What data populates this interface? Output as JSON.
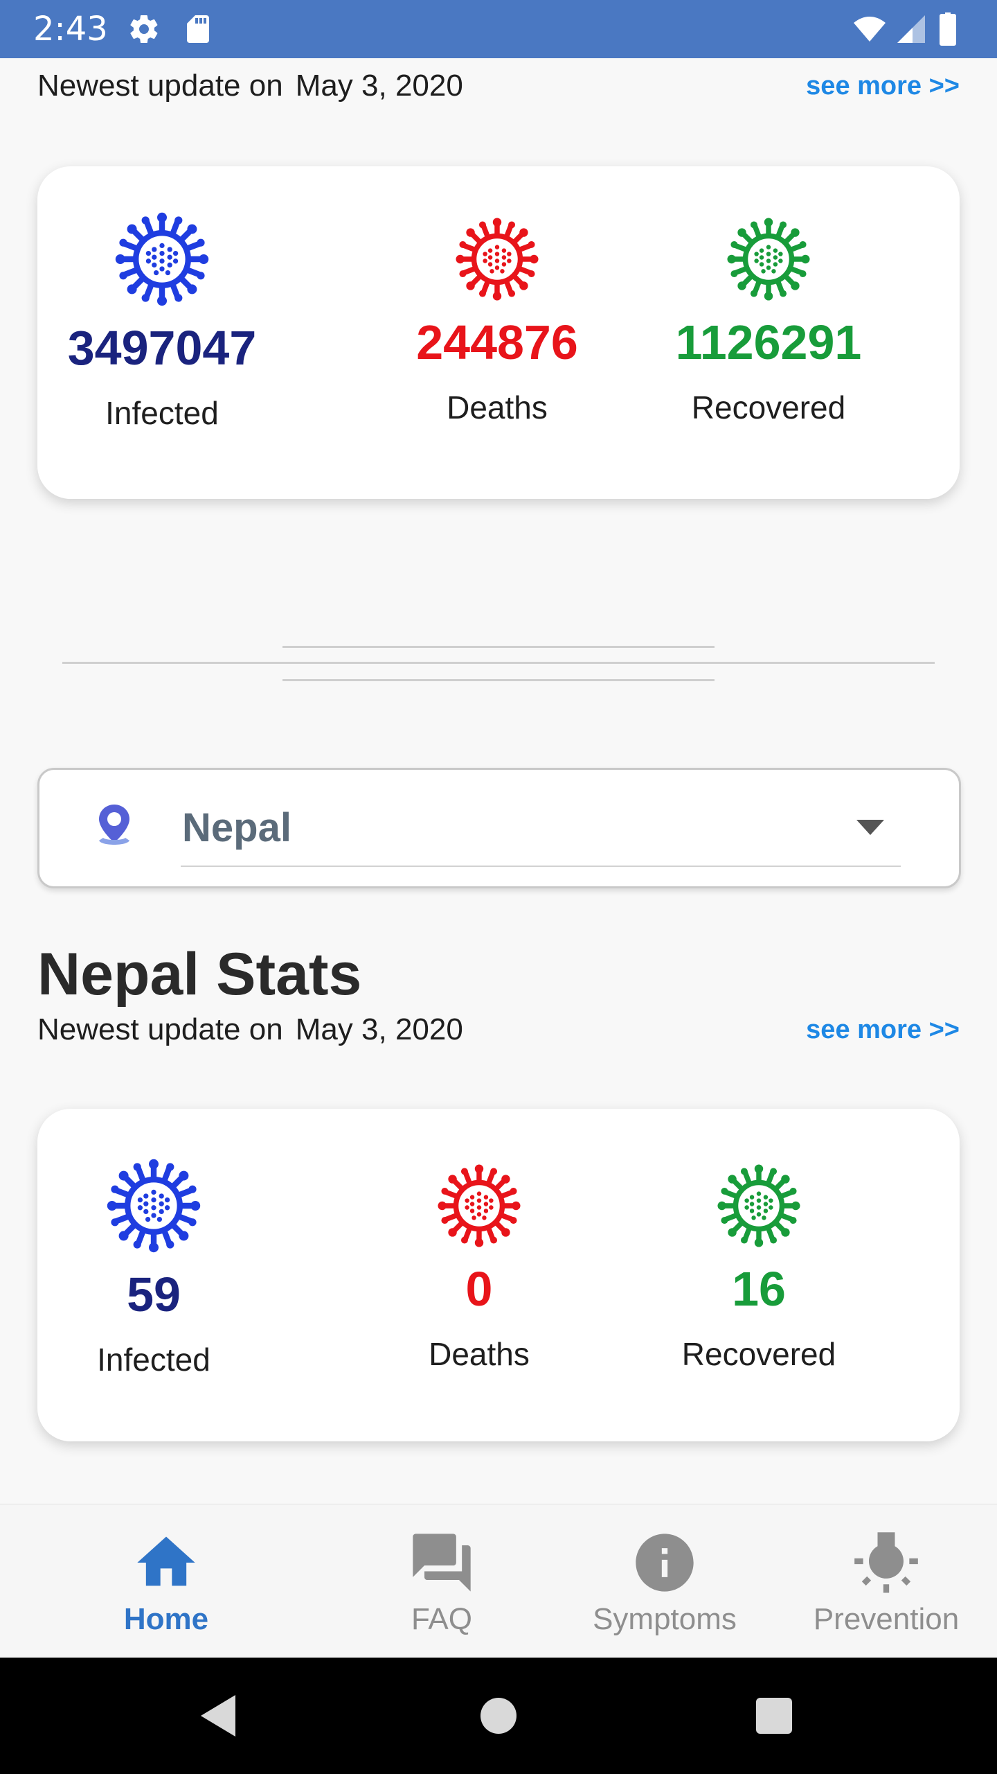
{
  "status_bar": {
    "time": "2:43",
    "bg_color": "#4a78c2",
    "icons": [
      "settings-icon",
      "sd-card-icon",
      "wifi-icon",
      "signal-icon",
      "battery-icon"
    ]
  },
  "global": {
    "update_prefix": "Newest update on",
    "update_date": "May 3, 2020",
    "see_more": "see more >>",
    "stats": {
      "infected": {
        "value": "3497047",
        "label": "Infected",
        "color": "#1a237e",
        "icon_color": "#1f3de0"
      },
      "deaths": {
        "value": "244876",
        "label": "Deaths",
        "color": "#e8141a",
        "icon_color": "#e8141a"
      },
      "recovered": {
        "value": "1126291",
        "label": "Recovered",
        "color": "#189c3a",
        "icon_color": "#189c3a"
      }
    }
  },
  "selector": {
    "icon": "location-pin-icon",
    "country": "Nepal"
  },
  "country_section": {
    "title": "Nepal Stats",
    "update_prefix": "Newest update on",
    "update_date": "May 3, 2020",
    "see_more": "see more >>",
    "stats": {
      "infected": {
        "value": "59",
        "label": "Infected"
      },
      "deaths": {
        "value": "0",
        "label": "Deaths"
      },
      "recovered": {
        "value": "16",
        "label": "Recovered"
      }
    }
  },
  "bottom_nav": {
    "active_color": "#2f74c7",
    "inactive_color": "#8e8e8e",
    "items": [
      {
        "label": "Home",
        "icon": "home-icon",
        "active": true
      },
      {
        "label": "FAQ",
        "icon": "forum-icon",
        "active": false
      },
      {
        "label": "Symptoms",
        "icon": "info-icon",
        "active": false
      },
      {
        "label": "Prevention",
        "icon": "lightbulb-icon",
        "active": false
      }
    ]
  },
  "system_nav": {
    "buttons": [
      "back-button",
      "home-button",
      "recents-button"
    ]
  }
}
